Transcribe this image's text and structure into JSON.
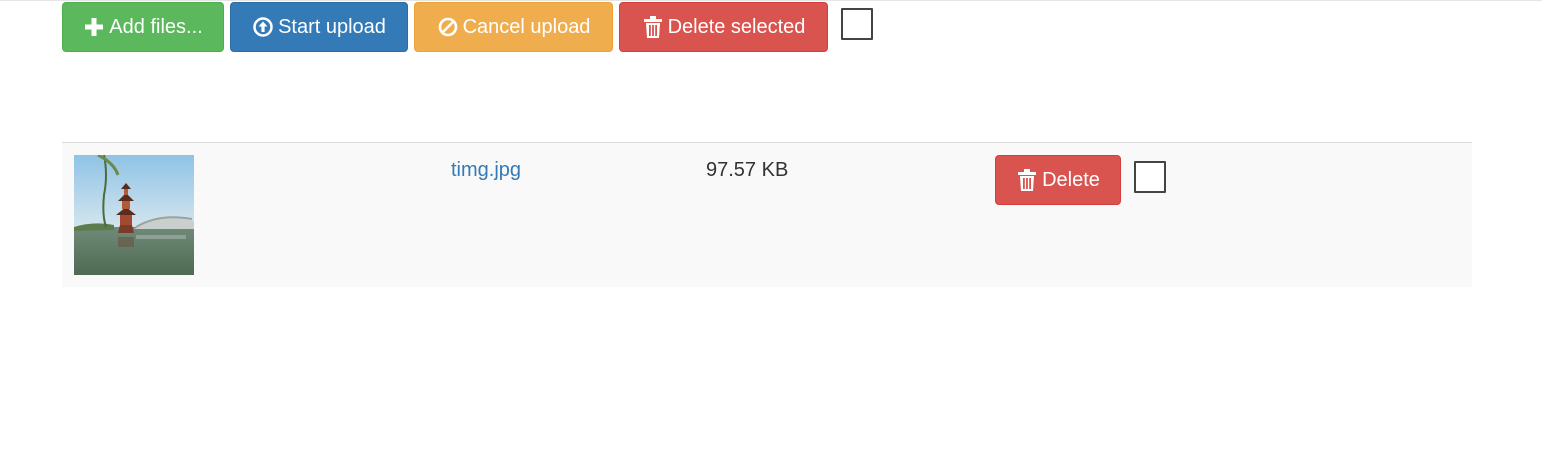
{
  "toolbar": {
    "add_files": {
      "label": "Add files...",
      "icon": "plus-icon",
      "color": "#5cb85c"
    },
    "start_upload": {
      "label": "Start upload",
      "icon": "circle-arrow-up-icon",
      "color": "#337ab7"
    },
    "cancel_upload": {
      "label": "Cancel upload",
      "icon": "ban-circle-icon",
      "color": "#f0ad4e"
    },
    "delete_selected": {
      "label": "Delete selected",
      "icon": "trash-icon",
      "color": "#d9534f"
    },
    "select_all_checked": false
  },
  "files": [
    {
      "name": "timg.jpg",
      "size": "97.57 KB",
      "thumbnail": "lake-pagoda-photo",
      "delete_label": "Delete",
      "delete_icon": "trash-icon",
      "checked": false
    }
  ]
}
